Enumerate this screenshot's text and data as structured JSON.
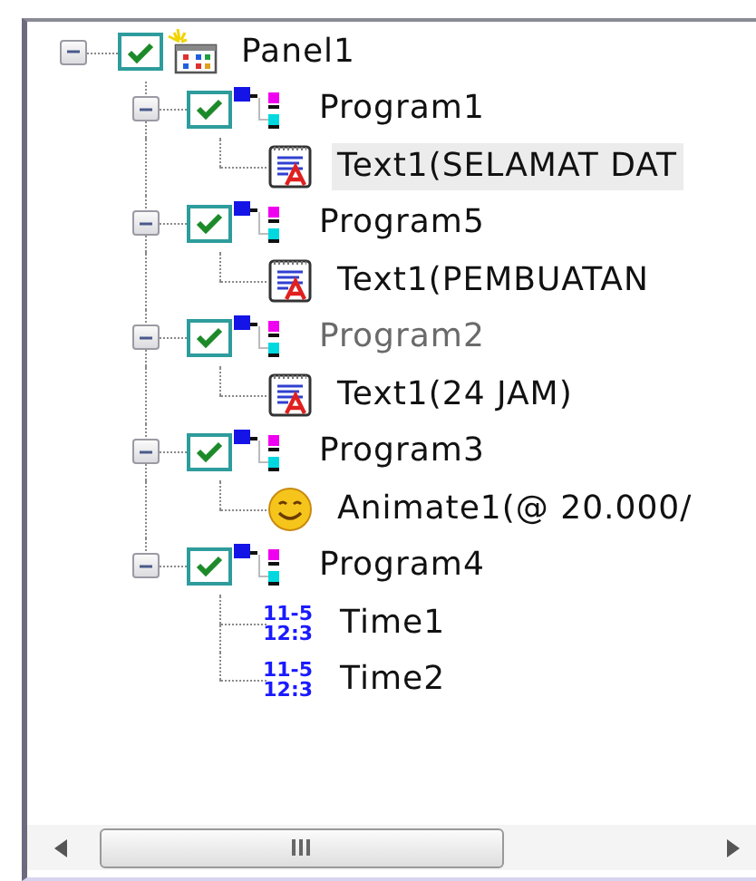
{
  "tree": [
    {
      "kind": "panel",
      "label": "Panel1",
      "checked": true,
      "expanded": true,
      "selected": false,
      "children": [
        {
          "kind": "program",
          "label": "Program1",
          "checked": true,
          "expanded": true,
          "disabled": false,
          "selected": false,
          "children": [
            {
              "kind": "text",
              "label": "Text1(SELAMAT DAT",
              "selected": true
            }
          ]
        },
        {
          "kind": "program",
          "label": "Program5",
          "checked": true,
          "expanded": true,
          "disabled": false,
          "selected": false,
          "children": [
            {
              "kind": "text",
              "label": "Text1(PEMBUATAN",
              "selected": false
            }
          ]
        },
        {
          "kind": "program",
          "label": "Program2",
          "checked": true,
          "expanded": true,
          "disabled": true,
          "selected": false,
          "children": [
            {
              "kind": "text",
              "label": "Text1(24 JAM)",
              "selected": false
            }
          ]
        },
        {
          "kind": "program",
          "label": "Program3",
          "checked": true,
          "expanded": true,
          "disabled": false,
          "selected": false,
          "children": [
            {
              "kind": "animate",
              "label": "Animate1(@ 20.000/",
              "selected": false
            }
          ]
        },
        {
          "kind": "program",
          "label": "Program4",
          "checked": true,
          "expanded": true,
          "disabled": false,
          "selected": false,
          "children": [
            {
              "kind": "time",
              "label": "Time1",
              "icon_text": [
                "11-5",
                "12:3"
              ],
              "selected": false
            },
            {
              "kind": "time",
              "label": "Time2",
              "icon_text": [
                "11-5",
                "12:3"
              ],
              "selected": false
            }
          ]
        }
      ]
    }
  ]
}
